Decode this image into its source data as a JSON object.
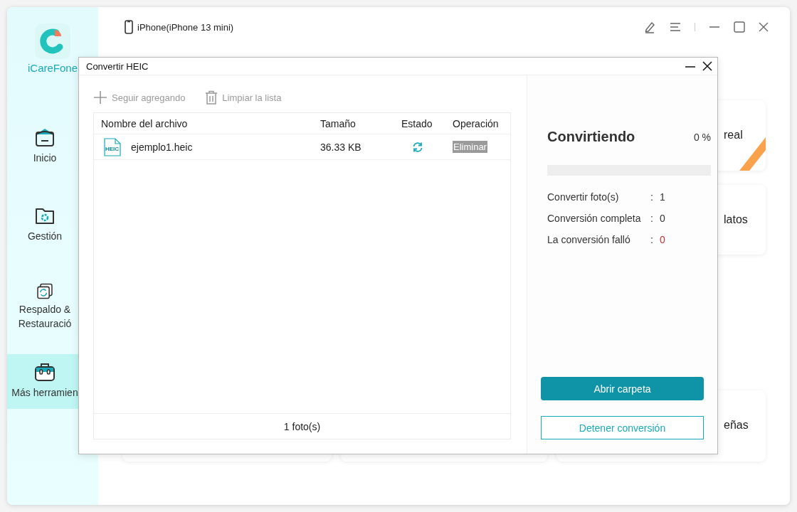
{
  "app": {
    "name": "iCareFone"
  },
  "sidebar": {
    "items": [
      {
        "label": "Inicio",
        "selected": false
      },
      {
        "label": "Gestión",
        "selected": false
      },
      {
        "label": "Respaldo & Restauració",
        "selected": false
      },
      {
        "label": "Más herramien",
        "selected": true
      }
    ]
  },
  "device": {
    "name": "iPhone(iPhone 13 mini)"
  },
  "background_cards": [
    {
      "text": "real"
    },
    {
      "text": "latos"
    },
    {
      "text": "eñas"
    }
  ],
  "dialog": {
    "title": "Convertir HEIC",
    "toolbar": [
      {
        "label": "Seguir agregando",
        "disabled": true
      },
      {
        "label": "Limpiar la lista",
        "disabled": true
      }
    ],
    "table": {
      "columns": [
        "Nombre del archivo",
        "Tamaño",
        "Estado",
        "Operación"
      ],
      "rows": [
        {
          "file_badge": "HEIC",
          "name": "ejemplo1.heic",
          "size": "36.33 KB",
          "converting": true,
          "operation": "Eliminar",
          "operation_disabled": true
        }
      ],
      "footer": "1 foto(s)"
    },
    "progress": {
      "title": "Convirtiendo",
      "reading": "0 %",
      "level": 0
    },
    "stats": [
      {
        "label": "Convertir foto(s)",
        "separator": ":",
        "value": "1",
        "kind": "normal"
      },
      {
        "label": "Conversión completa",
        "separator": ":",
        "value": "0",
        "kind": "normal"
      },
      {
        "label": "La conversión falló",
        "separator": ":",
        "value": "0",
        "kind": "error"
      }
    ],
    "buttons": [
      {
        "label": "Abrir carpeta",
        "kind": "primary"
      },
      {
        "label": "Detener conversión",
        "kind": "outline"
      }
    ]
  }
}
